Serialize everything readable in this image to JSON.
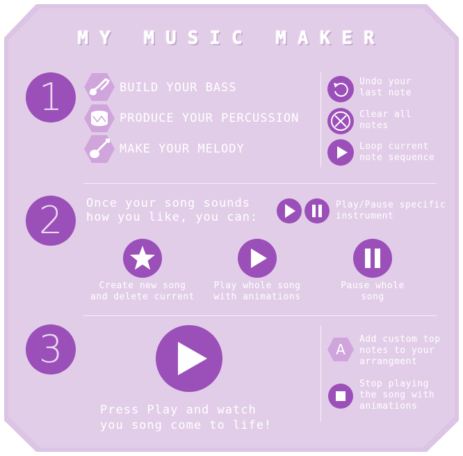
{
  "app_title": "MY MUSIC MAKER",
  "steps": [
    {
      "number": "1"
    },
    {
      "number": "2"
    },
    {
      "number": "3"
    }
  ],
  "step1": {
    "items": [
      {
        "label": "BUILD YOUR BASS",
        "icon": "bass-guitar-icon"
      },
      {
        "label": "PRODUCE YOUR PERCUSSION",
        "icon": "drum-icon"
      },
      {
        "label": "MAKE YOUR MELODY",
        "icon": "guitar-icon"
      }
    ],
    "controls": [
      {
        "label": "Undo your\nlast note",
        "icon": "undo-icon"
      },
      {
        "label": "Clear all\nnotes",
        "icon": "clear-icon"
      },
      {
        "label": "Loop current\nnote sequence",
        "icon": "loop-play-icon"
      }
    ]
  },
  "step2": {
    "text": "Once your song sounds\nhow you like, you can:",
    "play_pause_label": "Play/Pause specific\ninstrument",
    "actions": [
      {
        "label": "Create new song\nand delete current",
        "icon": "star-icon"
      },
      {
        "label": "Play whole song\nwith animations",
        "icon": "play-icon"
      },
      {
        "label": "Pause whole\nsong",
        "icon": "pause-icon"
      }
    ]
  },
  "step3": {
    "text": "Press Play and watch\nyou song come to life!",
    "controls": [
      {
        "label": "Add custom top\nnotes to your\narrangment",
        "icon": "letter-a-hex-icon",
        "glyph": "A"
      },
      {
        "label": "Stop playing\nthe song with\nanimations",
        "icon": "stop-icon"
      }
    ]
  },
  "colors": {
    "background": "#e2cde8",
    "accent": "#9b4fb8",
    "hex_fill": "#cfa5dc",
    "text": "#ffffff"
  }
}
